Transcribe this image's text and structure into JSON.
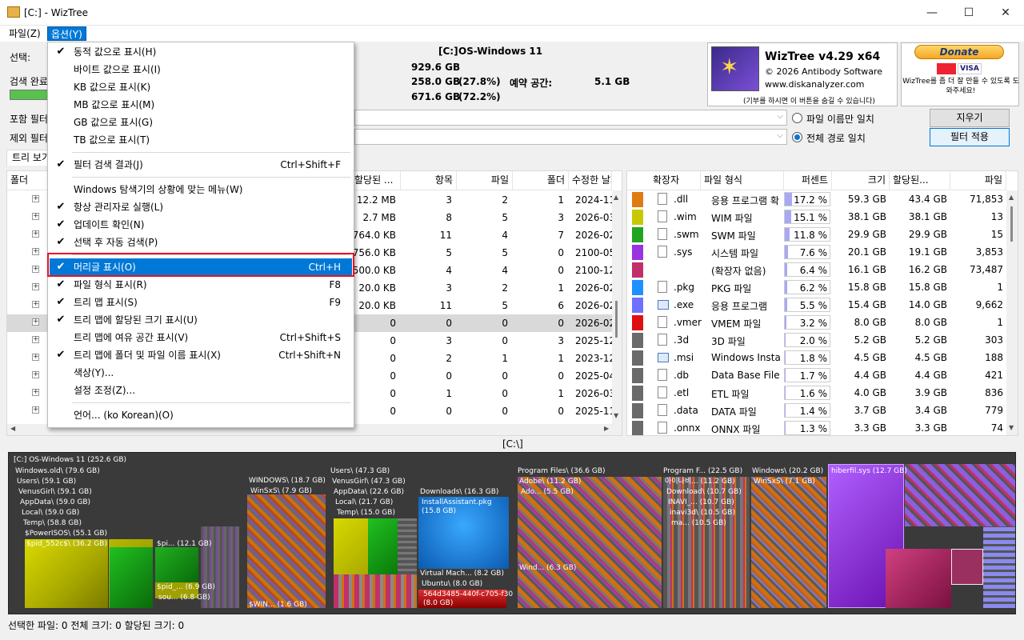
{
  "window": {
    "title": "[C:]  - WizTree",
    "min": "—",
    "max": "☐",
    "close": "✕"
  },
  "menubar": {
    "file": "파일(Z)",
    "options": "옵션(Y)"
  },
  "info": {
    "select_label": "선택:",
    "scan_label": "검색 완료",
    "drive_tag": "[C:]",
    "drive_name": "OS-Windows 11",
    "total": "929.6 GB",
    "used": "258.0 GB",
    "used_pct": "(27.8%)",
    "free": "671.6 GB",
    "free_pct": "(72.2%)",
    "reserved_label": "예약 공간:",
    "reserved": "5.1 GB"
  },
  "logo": {
    "name": "WizTree v4.29 x64",
    "copyright": "© 2026 Antibody Software",
    "url": "www.diskanalyzer.com",
    "donate_note": "(기부를 하시면 이 버튼을 숨길 수 있습니다)"
  },
  "donate": {
    "label": "Donate",
    "cards": "VISA",
    "text": "WizTree를 좀 더 잘 만들 수 있도록 도와주세요!"
  },
  "filters": {
    "include_label": "포함 필터",
    "exclude_label": "제외 필터",
    "radio_name": "파일 이름만 일치",
    "radio_path": "전체 경로 일치",
    "clear_btn": "지우기",
    "apply_btn": "필터 적용"
  },
  "tabs": {
    "tree": "트리 보기"
  },
  "tree": {
    "headers": {
      "folder": "폴더",
      "allocated": "할당된 ...",
      "items": "항목",
      "files": "파일",
      "folders": "폴더",
      "modified": "수정한 날짜"
    },
    "rows": [
      {
        "alloc": "12.2 MB",
        "items": "3",
        "files": "2",
        "folders": "1",
        "date": "2024-11"
      },
      {
        "alloc": "2.7 MB",
        "items": "8",
        "files": "5",
        "folders": "3",
        "date": "2026-03"
      },
      {
        "alloc": "764.0 KB",
        "items": "11",
        "files": "4",
        "folders": "7",
        "date": "2026-02"
      },
      {
        "alloc": "756.0 KB",
        "items": "5",
        "files": "5",
        "folders": "0",
        "date": "2100-05"
      },
      {
        "alloc": "500.0 KB",
        "items": "4",
        "files": "4",
        "folders": "0",
        "date": "2100-12"
      },
      {
        "alloc": "20.0 KB",
        "items": "3",
        "files": "2",
        "folders": "1",
        "date": "2026-02"
      },
      {
        "alloc": "20.0 KB",
        "items": "11",
        "files": "5",
        "folders": "6",
        "date": "2026-02"
      },
      {
        "alloc": "0",
        "items": "0",
        "files": "0",
        "folders": "0",
        "date": "2026-02"
      },
      {
        "alloc": "0",
        "items": "3",
        "files": "0",
        "folders": "3",
        "date": "2025-12"
      },
      {
        "alloc": "0",
        "items": "2",
        "files": "1",
        "folders": "1",
        "date": "2023-12"
      },
      {
        "alloc": "0",
        "items": "0",
        "files": "0",
        "folders": "0",
        "date": "2025-04"
      },
      {
        "alloc": "0",
        "items": "1",
        "files": "0",
        "folders": "1",
        "date": "2026-03"
      },
      {
        "alloc": "0",
        "items": "0",
        "files": "0",
        "folders": "0",
        "date": "2025-11"
      }
    ]
  },
  "ext": {
    "headers": {
      "ext": "확장자",
      "type": "파일 형식",
      "percent": "퍼센트",
      "size": "크기",
      "allocated": "할당된...",
      "files": "파일"
    },
    "rows": [
      {
        "color": "#e07b12",
        "ext": ".dll",
        "type": "응용 프로그램 확",
        "pct": 17.2,
        "pct_text": "17.2 %",
        "size": "59.3 GB",
        "alloc": "43.4 GB",
        "files": "71,853",
        "icon": "dll-icon"
      },
      {
        "color": "#c8c800",
        "ext": ".wim",
        "type": "WIM 파일",
        "pct": 15.1,
        "pct_text": "15.1 %",
        "size": "38.1 GB",
        "alloc": "38.1 GB",
        "files": "13",
        "icon": "file-icon"
      },
      {
        "color": "#1fa51f",
        "ext": ".swm",
        "type": "SWM 파일",
        "pct": 11.8,
        "pct_text": "11.8 %",
        "size": "29.9 GB",
        "alloc": "29.9 GB",
        "files": "15",
        "icon": "file-icon"
      },
      {
        "color": "#9933e0",
        "ext": ".sys",
        "type": "시스템 파일",
        "pct": 7.6,
        "pct_text": "7.6 %",
        "size": "20.1 GB",
        "alloc": "19.1 GB",
        "files": "3,853",
        "icon": "sys-icon"
      },
      {
        "color": "#c0306a",
        "ext": "",
        "type": "(확장자 없음)",
        "pct": 6.4,
        "pct_text": "6.4 %",
        "size": "16.1 GB",
        "alloc": "16.2 GB",
        "files": "73,487",
        "icon": ""
      },
      {
        "color": "#1e90ff",
        "ext": ".pkg",
        "type": "PKG 파일",
        "pct": 6.2,
        "pct_text": "6.2 %",
        "size": "15.8 GB",
        "alloc": "15.8 GB",
        "files": "1",
        "icon": "file-icon"
      },
      {
        "color": "#7070ff",
        "ext": ".exe",
        "type": "응용 프로그램",
        "pct": 5.5,
        "pct_text": "5.5 %",
        "size": "15.4 GB",
        "alloc": "14.0 GB",
        "files": "9,662",
        "icon": "exe-icon"
      },
      {
        "color": "#e01010",
        "ext": ".vmer",
        "type": "VMEM 파일",
        "pct": 3.2,
        "pct_text": "3.2 %",
        "size": "8.0 GB",
        "alloc": "8.0 GB",
        "files": "1",
        "icon": "file-icon"
      },
      {
        "color": "#6a6a6a",
        "ext": ".3d",
        "type": "3D 파일",
        "pct": 2.0,
        "pct_text": "2.0 %",
        "size": "5.2 GB",
        "alloc": "5.2 GB",
        "files": "303",
        "icon": "file-icon"
      },
      {
        "color": "#6a6a6a",
        "ext": ".msi",
        "type": "Windows Installe",
        "pct": 1.8,
        "pct_text": "1.8 %",
        "size": "4.5 GB",
        "alloc": "4.5 GB",
        "files": "188",
        "icon": "msi-icon"
      },
      {
        "color": "#6a6a6a",
        "ext": ".db",
        "type": "Data Base File",
        "pct": 1.7,
        "pct_text": "1.7 %",
        "size": "4.4 GB",
        "alloc": "4.4 GB",
        "files": "421",
        "icon": "db-icon"
      },
      {
        "color": "#6a6a6a",
        "ext": ".etl",
        "type": "ETL 파일",
        "pct": 1.6,
        "pct_text": "1.6 %",
        "size": "4.0 GB",
        "alloc": "3.9 GB",
        "files": "836",
        "icon": "file-icon"
      },
      {
        "color": "#6a6a6a",
        "ext": ".data",
        "type": "DATA 파일",
        "pct": 1.4,
        "pct_text": "1.4 %",
        "size": "3.7 GB",
        "alloc": "3.4 GB",
        "files": "779",
        "icon": "file-icon"
      },
      {
        "color": "#6a6a6a",
        "ext": ".onnx",
        "type": "ONNX 파일",
        "pct": 1.3,
        "pct_text": "1.3 %",
        "size": "3.3 GB",
        "alloc": "3.3 GB",
        "files": "74",
        "icon": "file-icon"
      }
    ]
  },
  "treemap": {
    "path": "[C:\\]",
    "labels": {
      "root": "[C:] OS-Windows 11  (252.6 GB)",
      "winold": "Windows.old\\  (79.6 GB)",
      "users1": "Users\\  (59.1 GB)",
      "venus1": "VenusGirl\\  (59.1 GB)",
      "appdata1": "AppData\\  (59.0 GB)",
      "local1": "Local\\  (59.0 GB)",
      "temp1": "Temp\\  (58.8 GB)",
      "powerisos": "$PowerISOS\\  (55.1 GB)",
      "pid1": "$pid_552c$\\  (36.2 GB)",
      "pi2": "$pi...  (12.1 GB)",
      "pid3": "$pid_...  (6.9 GB)",
      "sou": "sou...  (6.8 GB)",
      "windows1": "WINDOWS\\  (18.7 GB)",
      "winsxs1": "WinSxS\\  (7.9 GB)",
      "win1": "$WIN...  (1.6 GB)",
      "users2": "Users\\  (47.3 GB)",
      "venus2": "VenusGirl\\  (47.3 GB)",
      "appdata2": "AppData\\  (22.6 GB)",
      "local2": "Local\\  (21.7 GB)",
      "temp2": "Temp\\  (15.0 GB)",
      "downloads": "Downloads\\  (16.3 GB)",
      "installassistant": "InstallAssistant.pkg  (15.8 GB)",
      "virtualmach": "Virtual Mach...  (8.2 GB)",
      "ubuntu": "Ubuntu\\  (8.0 GB)",
      "vmem": "564d3485-440f-c705-f30",
      "vmemsize": "(8.0 GB)",
      "progfiles": "Program Files\\  (36.6 GB)",
      "adobe": "Adobe\\  (11.2 GB)",
      "ado": "Ado...  (5.5 GB)",
      "wind": "Wind...  (6.3 GB)",
      "progf2": "Program F...  (22.5 GB)",
      "inavi1": "아이나비...  (11.2 GB)",
      "download2": "Download\\  (10.7 GB)",
      "inavi2": "INAVI_...  (10.7 GB)",
      "inavi3": "inavi3d\\  (10.5 GB)",
      "ma": "ma...  (10.5 GB)",
      "windows2": "Windows\\  (20.2 GB)",
      "winsxs2": "WinSxS\\  (7.1 GB)",
      "hiberfil": "hiberfil.sys  (12.7 GB)"
    }
  },
  "status": {
    "text": "선택한 파일: 0  전체 크기: 0  할당된 크기: 0"
  },
  "dropdown": {
    "items": [
      {
        "label": "동적 값으로 표시(H)",
        "checked": true,
        "shortcut": ""
      },
      {
        "label": "바이트 값으로 표시(I)",
        "checked": false,
        "shortcut": ""
      },
      {
        "label": "KB 값으로 표시(K)",
        "checked": false,
        "shortcut": ""
      },
      {
        "label": "MB 값으로 표시(M)",
        "checked": false,
        "shortcut": ""
      },
      {
        "label": "GB 값으로 표시(G)",
        "checked": false,
        "shortcut": ""
      },
      {
        "label": "TB 값으로 표시(T)",
        "checked": false,
        "shortcut": ""
      },
      {
        "label": "필터 검색 결과(J)",
        "checked": true,
        "shortcut": "Ctrl+Shift+F"
      },
      {
        "label": "Windows 탐색기의 상황에 맞는 메뉴(W)",
        "checked": false,
        "shortcut": ""
      },
      {
        "label": "항상 관리자로 실행(L)",
        "checked": true,
        "shortcut": ""
      },
      {
        "label": "업데이트 확인(N)",
        "checked": true,
        "shortcut": ""
      },
      {
        "label": "선택 후 자동 검색(P)",
        "checked": true,
        "shortcut": ""
      },
      {
        "label": "머리글 표시(O)",
        "checked": true,
        "shortcut": "Ctrl+H"
      },
      {
        "label": "파일 형식 표시(R)",
        "checked": true,
        "shortcut": "F8"
      },
      {
        "label": "트리 맵 표시(S)",
        "checked": true,
        "shortcut": "F9"
      },
      {
        "label": "트리 맵에 할당된 크기 표시(U)",
        "checked": true,
        "shortcut": ""
      },
      {
        "label": "트리 맵에 여유 공간 표시(V)",
        "checked": false,
        "shortcut": "Ctrl+Shift+S"
      },
      {
        "label": "트리 맵에 폴더 및 파일 이름 표시(X)",
        "checked": true,
        "shortcut": "Ctrl+Shift+N"
      },
      {
        "label": "색상(Y)...",
        "checked": false,
        "shortcut": ""
      },
      {
        "label": "설정 조정(Z)...",
        "checked": false,
        "shortcut": ""
      },
      {
        "label": "언어... (ko Korean)(O)",
        "checked": false,
        "shortcut": ""
      }
    ],
    "check_glyph": "✔"
  }
}
